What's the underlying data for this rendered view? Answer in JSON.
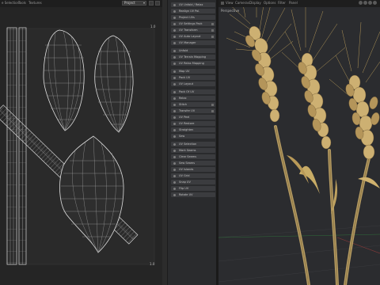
{
  "uv_editor": {
    "menu": [
      "e Selection",
      "Tools",
      "Textures"
    ],
    "mode_select": {
      "value": "Project"
    },
    "axis_labels": {
      "top_right": "1.0",
      "bottom_right": "1.0"
    }
  },
  "panel": {
    "rows": [
      "UV Unfold / Relax",
      "Realign UV Pol.",
      "Project UVs",
      "UV Settings Pack",
      "UV Transform",
      "UV Auto Layout",
      "UV Manager",
      "Unfold",
      "UV Terrain Mapping",
      "UV Relax Mapping",
      "Map UV",
      "Pack UV",
      "UV Layout",
      "Pack Of UV",
      "Relax",
      "Stitch",
      "Transfer UV",
      "UV Peel",
      "UV Restore",
      "Straighten",
      "Sew",
      "UV Selection",
      "Mark Seams",
      "Clear Seams",
      "Sew Seams",
      "UV Islands",
      "UV Grid",
      "Snap UV",
      "Flip UV",
      "Rotate UV",
      "Align UV",
      "Normalize",
      "Distribute",
      "Scale",
      "Shear",
      "Merge"
    ]
  },
  "viewport": {
    "menu": [
      "View",
      "Cameras",
      "Display",
      "Options",
      "Filter",
      "Panel"
    ],
    "title": "Perspective"
  }
}
